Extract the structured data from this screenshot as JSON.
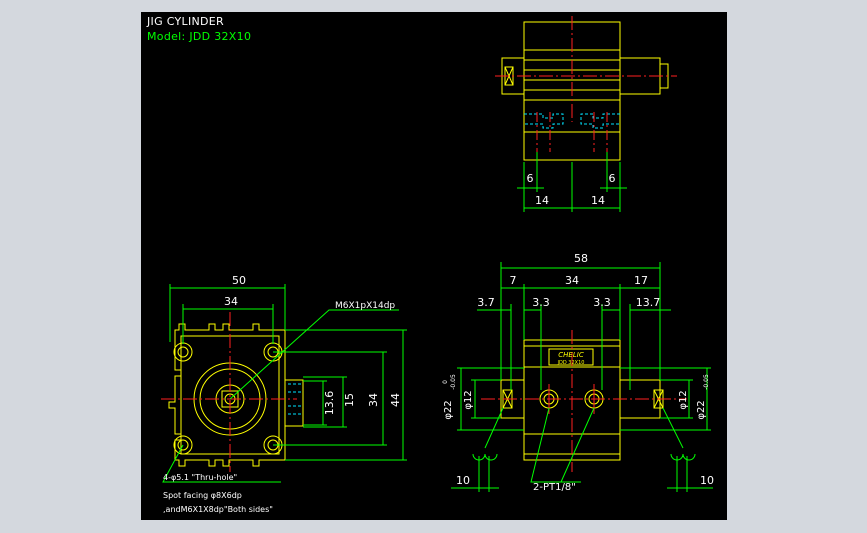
{
  "title": {
    "line1": "JIG CYLINDER",
    "line2": "Model:  JDD  32X10"
  },
  "colors": {
    "viewport_bg": "#000000",
    "surround_bg": "#d4d8de",
    "outline": "#ffff00",
    "dimension": "#00ff00",
    "centerline": "#ff2020",
    "hidden": "#00e5ff",
    "callout_text": "#ffffff",
    "title_text": "#ffffff",
    "model_text": "#00ff00"
  },
  "dimensions": {
    "top_view": {
      "d6_left": "6",
      "d6_right": "6",
      "d14_left": "14",
      "d14_right": "14"
    },
    "front_view": {
      "w50": "50",
      "w34": "34",
      "h13_6": "13.6",
      "h15": "15",
      "h34": "34",
      "h44": "44",
      "thread_callout": "M6X1pX14dp"
    },
    "side_view": {
      "d58": "58",
      "d7": "7",
      "d34": "34",
      "d17": "17",
      "d3_7_left": "3.7",
      "d3_3_left": "3.3",
      "d3_3_right": "3.3",
      "d13_7": "13.7",
      "phi22_left": "φ22",
      "phi12_left": "φ12",
      "phi12_right": "φ12",
      "phi22_right": "φ22",
      "tol": "-0.05",
      "tol0": "0",
      "d10_left": "10",
      "d10_right": "10",
      "port_callout": "2-PT1/8\"",
      "label_brand": "CHELIC",
      "label_model": "JDD 32X10"
    }
  },
  "notes": {
    "line1": "4-φ5.1 \"Thru-hole\"",
    "line2": "Spot facing φ8X6dp",
    "line3": ",andM6X1X8dp\"Both sides\""
  }
}
